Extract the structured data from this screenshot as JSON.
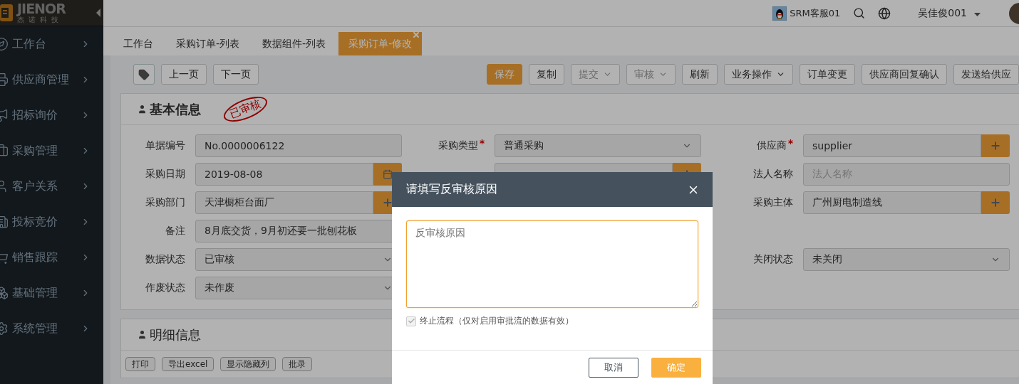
{
  "brand": {
    "name": "JIENOR",
    "subtitle": "杰诺科技"
  },
  "sidebar": {
    "items": [
      {
        "label": "工作台"
      },
      {
        "label": "供应商管理"
      },
      {
        "label": "招标询价"
      },
      {
        "label": "采购管理"
      },
      {
        "label": "客户关系"
      },
      {
        "label": "投标竞价"
      },
      {
        "label": "销售跟踪"
      },
      {
        "label": "基础管理"
      },
      {
        "label": "系统管理"
      }
    ]
  },
  "header": {
    "service": "SRM客服01",
    "user": "吴佳俊001"
  },
  "tabs": [
    {
      "label": "工作台",
      "selected": false
    },
    {
      "label": "采购订单-列表",
      "selected": false
    },
    {
      "label": "数据组件-列表",
      "selected": false
    },
    {
      "label": "采购订单-修改",
      "selected": true
    }
  ],
  "toolbar": {
    "left": [
      "上一页",
      "下一页"
    ],
    "right": [
      {
        "label": "保存",
        "kind": "primary",
        "dropdown": false,
        "disabled": false
      },
      {
        "label": "复制",
        "kind": "default",
        "dropdown": false,
        "disabled": false
      },
      {
        "label": "提交",
        "kind": "default",
        "dropdown": true,
        "disabled": true
      },
      {
        "label": "审核",
        "kind": "default",
        "dropdown": true,
        "disabled": true
      },
      {
        "label": "刷新",
        "kind": "default",
        "dropdown": false,
        "disabled": false
      },
      {
        "label": "业务操作",
        "kind": "default",
        "dropdown": true,
        "disabled": false
      },
      {
        "label": "订单变更",
        "kind": "default",
        "dropdown": false,
        "disabled": false
      },
      {
        "label": "供应商回复确认",
        "kind": "default",
        "dropdown": false,
        "disabled": false
      },
      {
        "label": "发送给供应",
        "kind": "default",
        "dropdown": false,
        "disabled": false
      }
    ]
  },
  "basic_info": {
    "title": "基本信息",
    "stamp": "已审核",
    "rows": [
      [
        {
          "label": "单据编号",
          "required": false,
          "kind": "text",
          "value": "No.0000006122"
        },
        {
          "label": "采购类型",
          "required": true,
          "kind": "select",
          "value": "普通采购"
        },
        {
          "label": "供应商",
          "required": true,
          "kind": "lookup",
          "value": "supplier"
        }
      ],
      [
        {
          "label": "采购日期",
          "required": false,
          "kind": "date",
          "value": "2019-08-08"
        },
        {
          "kind": "lookup"
        },
        {
          "label": "法人名称",
          "required": false,
          "kind": "text",
          "placeholder": "法人名称"
        }
      ],
      [
        {
          "label": "采购部门",
          "required": false,
          "kind": "lookup",
          "value": "天津橱柜台面厂"
        },
        null,
        {
          "label": "采购主体",
          "required": false,
          "kind": "lookup",
          "value": "广州厨电制造线"
        }
      ],
      [
        {
          "label": "备注",
          "required": false,
          "kind": "text",
          "value": "8月底交货，9月初还要一批刨花板"
        },
        null,
        null
      ],
      [
        {
          "label": "数据状态",
          "required": false,
          "kind": "select",
          "value": "已审核"
        },
        null,
        {
          "label": "关闭状态",
          "required": false,
          "kind": "select",
          "value": "未关闭"
        }
      ],
      [
        {
          "label": "作废状态",
          "required": false,
          "kind": "select",
          "value": "未作废"
        },
        null,
        null
      ]
    ]
  },
  "detail_info": {
    "title": "明细信息",
    "buttons": [
      "打印",
      "导出excel",
      "显示隐藏列",
      "批录"
    ]
  },
  "dialog": {
    "title": "请填写反审核原因",
    "placeholder": "反审核原因",
    "checkbox": {
      "label": "终止流程（仅对启用审批流的数据有效）",
      "checked": true,
      "disabled": true
    },
    "buttons": [
      {
        "label": "取消",
        "kind": "default"
      },
      {
        "label": "确定",
        "kind": "primary"
      }
    ]
  }
}
